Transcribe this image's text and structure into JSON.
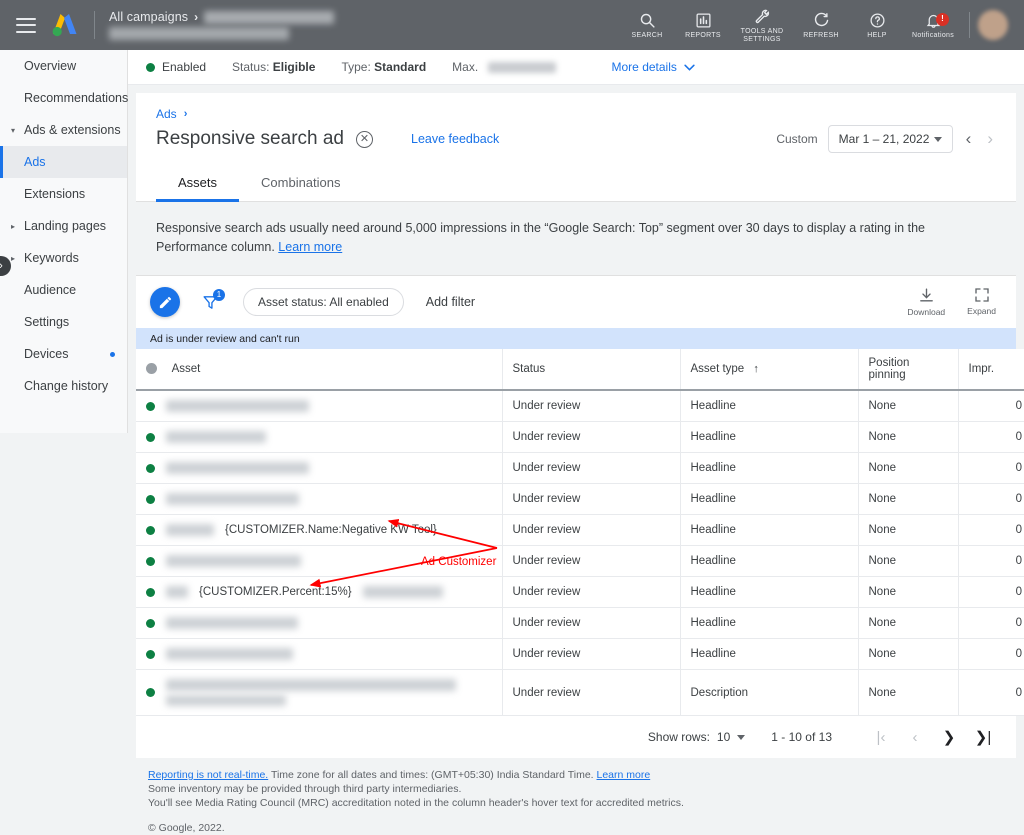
{
  "topbar": {
    "menu_icon": "hamburger-menu-icon",
    "logo": "google-ads-logo",
    "breadcrumb_root": "All campaigns",
    "breadcrumb_separator": "›",
    "nav": [
      {
        "label": "SEARCH",
        "icon": "search-icon"
      },
      {
        "label": "REPORTS",
        "icon": "reports-bar-chart-icon"
      },
      {
        "label": "TOOLS AND SETTINGS",
        "icon": "wrench-tools-icon"
      },
      {
        "label": "REFRESH",
        "icon": "refresh-icon"
      },
      {
        "label": "HELP",
        "icon": "help-question-icon"
      },
      {
        "label": "Notifications",
        "icon": "bell-notification-icon",
        "badge": "!"
      }
    ],
    "avatar": "user-avatar"
  },
  "sidebar": {
    "items": [
      {
        "label": "Overview",
        "selected": false,
        "expandable": false
      },
      {
        "label": "Recommendations",
        "selected": false,
        "expandable": false
      },
      {
        "label": "Ads & extensions",
        "selected": false,
        "expandable": true,
        "expanded": true
      },
      {
        "label": "Ads",
        "selected": true,
        "sub": true
      },
      {
        "label": "Extensions",
        "selected": false,
        "sub": true
      },
      {
        "label": "Landing pages",
        "selected": false,
        "expandable": true
      },
      {
        "label": "Keywords",
        "selected": false,
        "expandable": true
      },
      {
        "label": "Audience",
        "selected": false
      },
      {
        "label": "Settings",
        "selected": false
      },
      {
        "label": "Devices",
        "selected": false,
        "dot": true
      },
      {
        "label": "Change history",
        "selected": false
      }
    ],
    "collapse_handle": "›"
  },
  "statusbar": {
    "state": "Enabled",
    "status_label": "Status:",
    "status_value": "Eligible",
    "type_label": "Type:",
    "type_value": "Standard",
    "max_label": "Max.",
    "more_details": "More details"
  },
  "header": {
    "breadcrumb_ads": "Ads",
    "breadcrumb_chevron": "›",
    "title": "Responsive search ad",
    "close_icon": "close-x-circle-icon",
    "leave_feedback": "Leave feedback",
    "date": {
      "preset_label": "Custom",
      "range": "Mar 1 – 21, 2022",
      "prev_icon": "chevron-left-icon",
      "next_icon": "chevron-right-icon"
    }
  },
  "tabs": [
    {
      "label": "Assets",
      "active": true
    },
    {
      "label": "Combinations",
      "active": false
    }
  ],
  "info_note": {
    "text": "Responsive search ads usually need around 5,000 impressions in the “Google Search: Top” segment over 30 days to display a rating in the Performance column.",
    "link": "Learn more"
  },
  "toolbar": {
    "edit_icon": "edit-pencil-fab",
    "filter_icon": "filter-funnel-icon",
    "filter_badge": "1",
    "filter_chip": "Asset status: All enabled",
    "add_filter": "Add filter",
    "download": "Download",
    "download_icon": "download-icon",
    "expand": "Expand",
    "expand_icon": "expand-fullscreen-icon"
  },
  "review_notice": "Ad is under review and can't run",
  "table": {
    "columns": [
      "Asset",
      "Status",
      "Asset type",
      "Position pinning",
      "Impr."
    ],
    "sorted_column": "Asset type",
    "sort_direction": "↑",
    "rows": [
      {
        "asset_text": "",
        "blur_width": 143,
        "status": "Under review",
        "type": "Headline",
        "pinning": "None",
        "impr": "0"
      },
      {
        "asset_text": "",
        "blur_width": 100,
        "status": "Under review",
        "type": "Headline",
        "pinning": "None",
        "impr": "0"
      },
      {
        "asset_text": "",
        "blur_width": 143,
        "status": "Under review",
        "type": "Headline",
        "pinning": "None",
        "impr": "0"
      },
      {
        "asset_text": "",
        "blur_width": 133,
        "status": "Under review",
        "type": "Headline",
        "pinning": "None",
        "impr": "0"
      },
      {
        "asset_text": "{CUSTOMIZER.Name:Negative KW Tool}",
        "blur_width": 48,
        "status": "Under review",
        "type": "Headline",
        "pinning": "None",
        "impr": "0"
      },
      {
        "asset_text": "",
        "blur_width": 135,
        "status": "Under review",
        "type": "Headline",
        "pinning": "None",
        "impr": "0"
      },
      {
        "asset_text": "{CUSTOMIZER.Percent:15%}",
        "blur_width": 22,
        "blur_tail": 80,
        "status": "Under review",
        "type": "Headline",
        "pinning": "None",
        "impr": "0"
      },
      {
        "asset_text": "",
        "blur_width": 132,
        "status": "Under review",
        "type": "Headline",
        "pinning": "None",
        "impr": "0"
      },
      {
        "asset_text": "",
        "blur_width": 127,
        "status": "Under review",
        "type": "Headline",
        "pinning": "None",
        "impr": "0"
      },
      {
        "asset_text": "",
        "blur_width": 290,
        "blur_width2": 120,
        "two_line": true,
        "status": "Under review",
        "type": "Description",
        "pinning": "None",
        "impr": "0"
      }
    ]
  },
  "pagination": {
    "show_rows_label": "Show rows:",
    "show_rows_value": "10",
    "range": "1 - 10 of 13",
    "first_icon": "first-page-icon",
    "prev_icon": "prev-page-icon",
    "next_icon": "next-page-icon",
    "last_icon": "last-page-icon"
  },
  "footer": {
    "line1_link": "Reporting is not real-time.",
    "line1_rest": " Time zone for all dates and times: (GMT+05:30) India Standard Time. ",
    "line1_learn": "Learn more",
    "line2": "Some inventory may be provided through third party intermediaries.",
    "line3": "You'll see Media Rating Council (MRC) accreditation noted in the column header's hover text for accredited metrics.",
    "copyright": "© Google, 2022."
  },
  "annotation": {
    "label": "Ad Customizer",
    "color": "#ff0000"
  },
  "colors": {
    "topbar_bg": "#5f6368",
    "accent_blue": "#1a73e8",
    "status_green": "#0d8043",
    "notice_blue": "#d2e3fc",
    "page_bg": "#f1f3f4",
    "annotation_red": "#ff0000"
  }
}
